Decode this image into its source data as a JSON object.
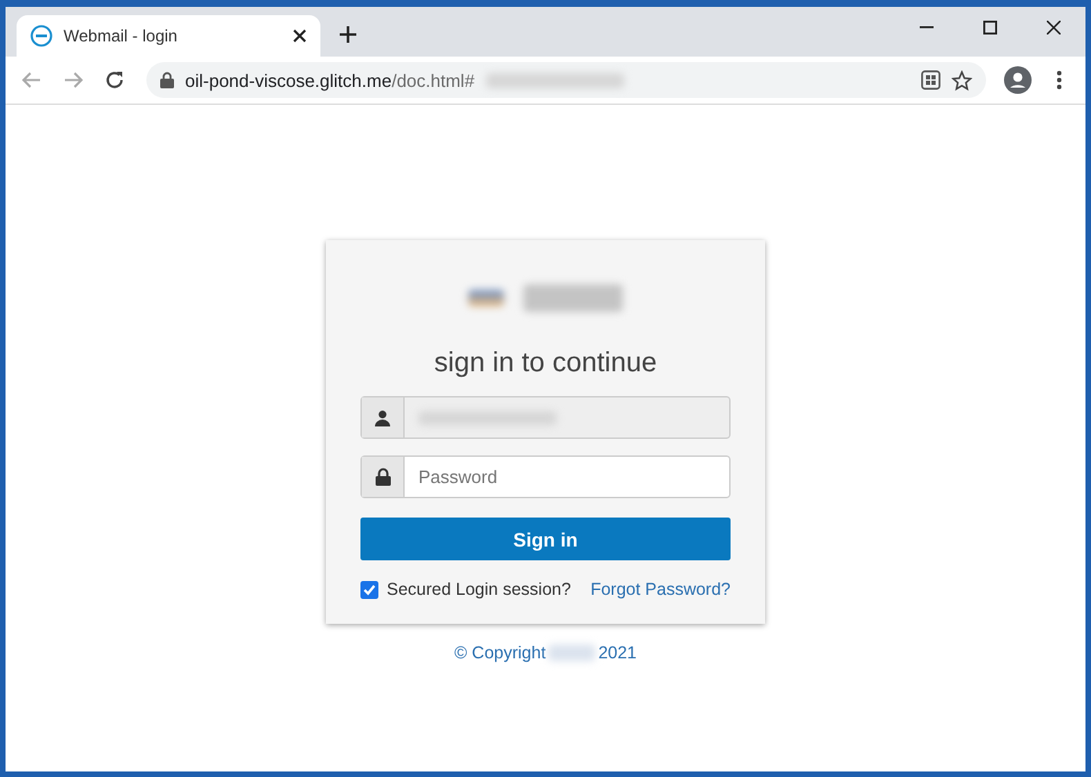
{
  "window": {
    "tab_title": "Webmail - login",
    "url_host": "oil-pond-viscose.glitch.me",
    "url_path": "/doc.html#"
  },
  "login": {
    "heading": "sign in to continue",
    "password_placeholder": "Password",
    "button": "Sign in",
    "remember": {
      "label": "Secured Login session?",
      "checked": true
    },
    "forgot": "Forgot Password?"
  },
  "footer": {
    "copyright": "© Copyright",
    "year": "2021"
  }
}
